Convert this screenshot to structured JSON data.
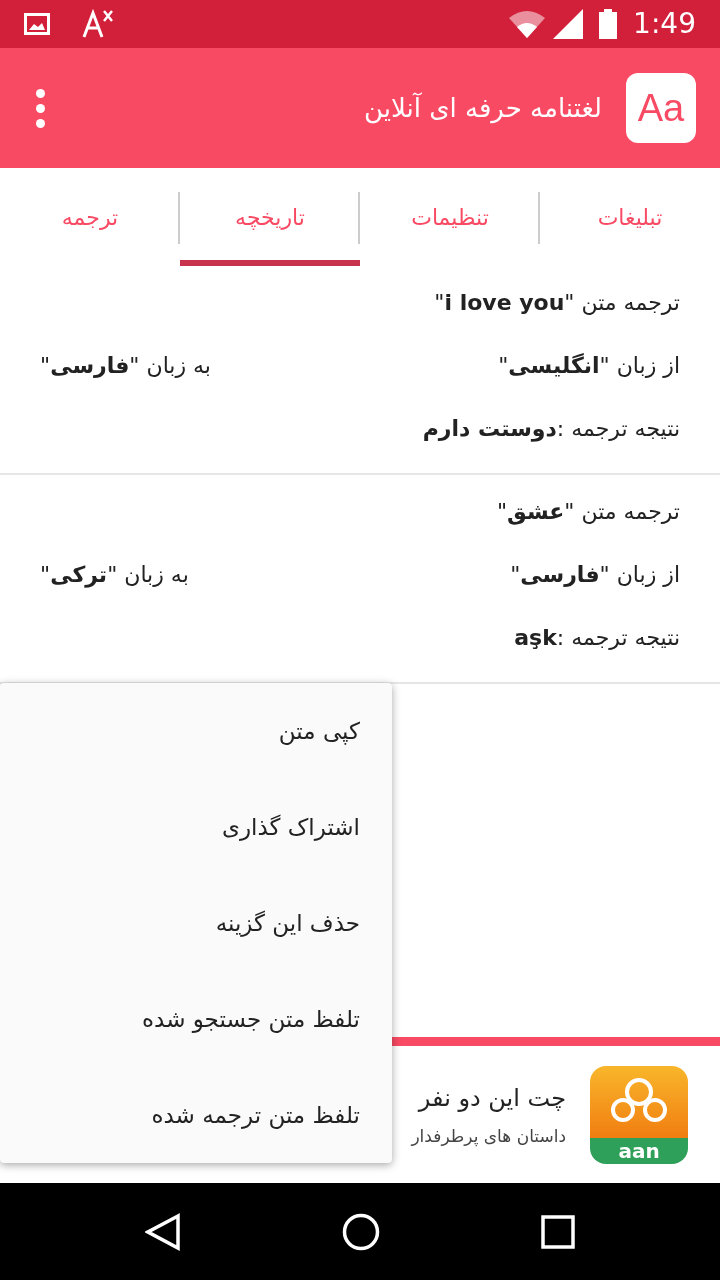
{
  "status_bar": {
    "time": "1:49"
  },
  "app_bar": {
    "logo": "Aa",
    "title": "لغتنامه حرفه ای آنلاین"
  },
  "tabs": [
    {
      "label": "تبلیغات",
      "selected": false
    },
    {
      "label": "تنظیمات",
      "selected": false
    },
    {
      "label": "تاریخچه",
      "selected": true
    },
    {
      "label": "ترجمه",
      "selected": false
    }
  ],
  "history": [
    {
      "source": "ترجمه متن \"**i love you**\"",
      "from": "از زبان \"**انگلیسی**\"",
      "to": "به زبان \"**فارسی**\"",
      "result": "نتیجه ترجمه :**دوستت دارم**"
    },
    {
      "source": "ترجمه متن \"**عشق**\"",
      "from": "از زبان \"**فارسی**\"",
      "to": "به زبان \"**ترکی**\"",
      "result": "نتیجه ترجمه :**aşk**"
    }
  ],
  "context_menu": [
    "کپی متن",
    "اشتراک گذاری",
    "حذف این گزینه",
    "تلفظ متن جستجو شده",
    "تلفظ متن ترجمه شده"
  ],
  "ad": {
    "icon_label": "aan",
    "title": "چت این دو نفر",
    "subtitle": "داستان های پرطرفدار"
  }
}
